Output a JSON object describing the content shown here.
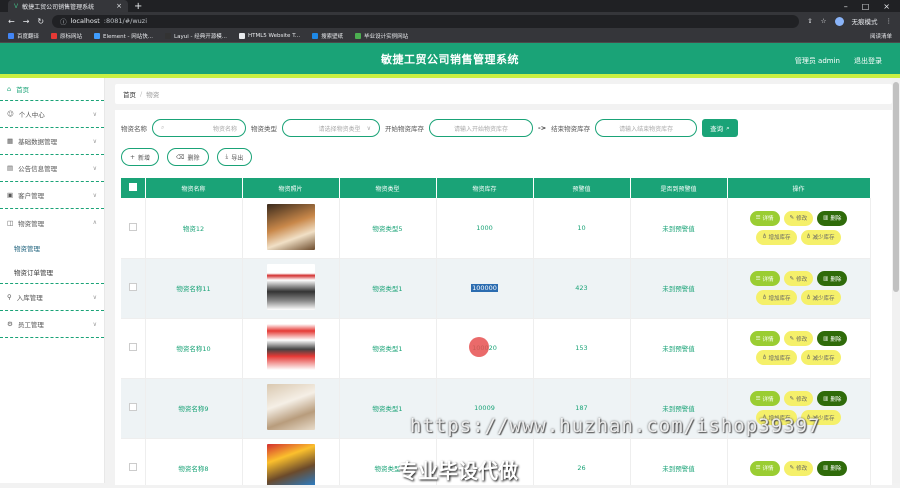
{
  "browser": {
    "tab_title": "敏捷工贸公司销售管理系统",
    "url_host": "localhost",
    "url_rest": ":8081/#/wuzi",
    "profile_label": "无痕模式",
    "bookmarks": [
      "百度翻译",
      "原标网站",
      "Element - 网站快...",
      "Layui - 经典开源模...",
      "HTML5 Website T...",
      "搜索壁纸",
      "毕业设计实例网站"
    ],
    "bookmarks_right": "阅读清单"
  },
  "header": {
    "title": "敏捷工贸公司销售管理系统",
    "user_label": "管理员 admin",
    "logout_label": "退出登录"
  },
  "sidebar": {
    "items": [
      {
        "label": "首页"
      },
      {
        "label": "个人中心"
      },
      {
        "label": "基础数据管理"
      },
      {
        "label": "公告信息管理"
      },
      {
        "label": "客户管理"
      },
      {
        "label": "物资管理"
      }
    ],
    "sub_items": [
      {
        "label": "物资管理"
      },
      {
        "label": "物资订单管理"
      }
    ],
    "after": [
      {
        "label": "入库管理"
      },
      {
        "label": "员工管理"
      }
    ]
  },
  "breadcrumb": {
    "home": "首页",
    "sep": "/",
    "current": "物资"
  },
  "filters": {
    "name_label": "物资名称",
    "name_placeholder": "物资名称",
    "type_label": "物资类型",
    "type_placeholder": "请选择物资类型",
    "start_label": "开始物资库存",
    "start_placeholder": "请输入开始物资库存",
    "arrow": "->",
    "end_label": "结束物资库存",
    "end_placeholder": "请输入结束物资库存",
    "query_label": "查询"
  },
  "toolbar": {
    "add": "新增",
    "delete": "删除",
    "export": "导出"
  },
  "table": {
    "columns": [
      "物资名称",
      "物资照片",
      "物资类型",
      "物资库存",
      "预警值",
      "是否到预警值",
      "操作"
    ],
    "rows": [
      {
        "name": "物资12",
        "type": "物资类型5",
        "stock": "1000",
        "warn": "10",
        "status": "未到预警值"
      },
      {
        "name": "物资名称11",
        "type": "物资类型1",
        "stock": "100000",
        "warn": "423",
        "status": "未到预警值"
      },
      {
        "name": "物资名称10",
        "type": "物资类型1",
        "stock": "100020",
        "warn": "153",
        "status": "未到预警值"
      },
      {
        "name": "物资名称9",
        "type": "物资类型1",
        "stock": "10009",
        "warn": "187",
        "status": "未到预警值"
      },
      {
        "name": "物资名称8",
        "type": "物资类型",
        "stock": "",
        "warn": "26",
        "status": "未到预警值"
      }
    ],
    "ops": {
      "detail": "详情",
      "edit": "修改",
      "delete": "删除",
      "increase": "增加库存",
      "decrease": "减少库存"
    }
  },
  "watermark": {
    "url": "https://www.huzhan.com/ishop39397",
    "text": "专业毕设代做"
  }
}
